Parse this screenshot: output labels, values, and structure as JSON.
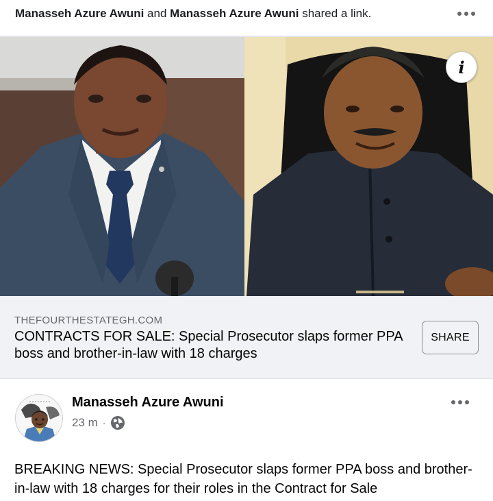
{
  "share_header": {
    "actor_1": "Manasseh Azure Awuni",
    "connector": "and",
    "actor_2": "Manasseh Azure Awuni",
    "action": "shared a link.",
    "more_icon": "three-dots-icon"
  },
  "link_preview": {
    "info_icon": "info-icon",
    "info_glyph": "i",
    "domain": "THEFOURTHESTATEGH.COM",
    "title": "CONTRACTS FOR SALE: Special Prosecutor slaps former PPA boss and brother-in-law with 18 charges",
    "share_label": "SHARE"
  },
  "post": {
    "author": "Manasseh Azure Awuni",
    "time": "23 m",
    "separator": "·",
    "privacy_icon": "globe-icon",
    "more_icon": "three-dots-icon",
    "text": "BREAKING NEWS: Special Prosecutor slaps former PPA boss and brother-in-law with 18 charges for their roles in the Contract for Sale"
  },
  "colors": {
    "secondary_text": "#65676b",
    "card_background": "#f0f2f5",
    "primary_text": "#050505"
  }
}
